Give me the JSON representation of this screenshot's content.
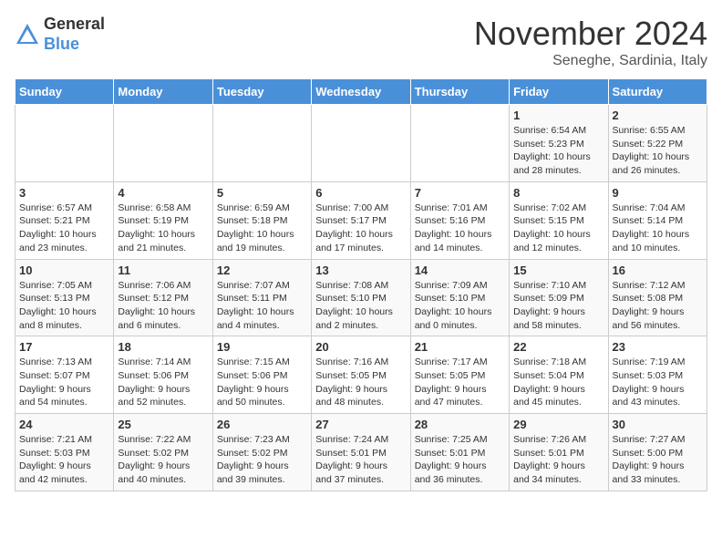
{
  "logo": {
    "general": "General",
    "blue": "Blue"
  },
  "title": "November 2024",
  "location": "Seneghe, Sardinia, Italy",
  "days_of_week": [
    "Sunday",
    "Monday",
    "Tuesday",
    "Wednesday",
    "Thursday",
    "Friday",
    "Saturday"
  ],
  "weeks": [
    [
      {
        "day": "",
        "info": ""
      },
      {
        "day": "",
        "info": ""
      },
      {
        "day": "",
        "info": ""
      },
      {
        "day": "",
        "info": ""
      },
      {
        "day": "",
        "info": ""
      },
      {
        "day": "1",
        "info": "Sunrise: 6:54 AM\nSunset: 5:23 PM\nDaylight: 10 hours\nand 28 minutes."
      },
      {
        "day": "2",
        "info": "Sunrise: 6:55 AM\nSunset: 5:22 PM\nDaylight: 10 hours\nand 26 minutes."
      }
    ],
    [
      {
        "day": "3",
        "info": "Sunrise: 6:57 AM\nSunset: 5:21 PM\nDaylight: 10 hours\nand 23 minutes."
      },
      {
        "day": "4",
        "info": "Sunrise: 6:58 AM\nSunset: 5:19 PM\nDaylight: 10 hours\nand 21 minutes."
      },
      {
        "day": "5",
        "info": "Sunrise: 6:59 AM\nSunset: 5:18 PM\nDaylight: 10 hours\nand 19 minutes."
      },
      {
        "day": "6",
        "info": "Sunrise: 7:00 AM\nSunset: 5:17 PM\nDaylight: 10 hours\nand 17 minutes."
      },
      {
        "day": "7",
        "info": "Sunrise: 7:01 AM\nSunset: 5:16 PM\nDaylight: 10 hours\nand 14 minutes."
      },
      {
        "day": "8",
        "info": "Sunrise: 7:02 AM\nSunset: 5:15 PM\nDaylight: 10 hours\nand 12 minutes."
      },
      {
        "day": "9",
        "info": "Sunrise: 7:04 AM\nSunset: 5:14 PM\nDaylight: 10 hours\nand 10 minutes."
      }
    ],
    [
      {
        "day": "10",
        "info": "Sunrise: 7:05 AM\nSunset: 5:13 PM\nDaylight: 10 hours\nand 8 minutes."
      },
      {
        "day": "11",
        "info": "Sunrise: 7:06 AM\nSunset: 5:12 PM\nDaylight: 10 hours\nand 6 minutes."
      },
      {
        "day": "12",
        "info": "Sunrise: 7:07 AM\nSunset: 5:11 PM\nDaylight: 10 hours\nand 4 minutes."
      },
      {
        "day": "13",
        "info": "Sunrise: 7:08 AM\nSunset: 5:10 PM\nDaylight: 10 hours\nand 2 minutes."
      },
      {
        "day": "14",
        "info": "Sunrise: 7:09 AM\nSunset: 5:10 PM\nDaylight: 10 hours\nand 0 minutes."
      },
      {
        "day": "15",
        "info": "Sunrise: 7:10 AM\nSunset: 5:09 PM\nDaylight: 9 hours\nand 58 minutes."
      },
      {
        "day": "16",
        "info": "Sunrise: 7:12 AM\nSunset: 5:08 PM\nDaylight: 9 hours\nand 56 minutes."
      }
    ],
    [
      {
        "day": "17",
        "info": "Sunrise: 7:13 AM\nSunset: 5:07 PM\nDaylight: 9 hours\nand 54 minutes."
      },
      {
        "day": "18",
        "info": "Sunrise: 7:14 AM\nSunset: 5:06 PM\nDaylight: 9 hours\nand 52 minutes."
      },
      {
        "day": "19",
        "info": "Sunrise: 7:15 AM\nSunset: 5:06 PM\nDaylight: 9 hours\nand 50 minutes."
      },
      {
        "day": "20",
        "info": "Sunrise: 7:16 AM\nSunset: 5:05 PM\nDaylight: 9 hours\nand 48 minutes."
      },
      {
        "day": "21",
        "info": "Sunrise: 7:17 AM\nSunset: 5:05 PM\nDaylight: 9 hours\nand 47 minutes."
      },
      {
        "day": "22",
        "info": "Sunrise: 7:18 AM\nSunset: 5:04 PM\nDaylight: 9 hours\nand 45 minutes."
      },
      {
        "day": "23",
        "info": "Sunrise: 7:19 AM\nSunset: 5:03 PM\nDaylight: 9 hours\nand 43 minutes."
      }
    ],
    [
      {
        "day": "24",
        "info": "Sunrise: 7:21 AM\nSunset: 5:03 PM\nDaylight: 9 hours\nand 42 minutes."
      },
      {
        "day": "25",
        "info": "Sunrise: 7:22 AM\nSunset: 5:02 PM\nDaylight: 9 hours\nand 40 minutes."
      },
      {
        "day": "26",
        "info": "Sunrise: 7:23 AM\nSunset: 5:02 PM\nDaylight: 9 hours\nand 39 minutes."
      },
      {
        "day": "27",
        "info": "Sunrise: 7:24 AM\nSunset: 5:01 PM\nDaylight: 9 hours\nand 37 minutes."
      },
      {
        "day": "28",
        "info": "Sunrise: 7:25 AM\nSunset: 5:01 PM\nDaylight: 9 hours\nand 36 minutes."
      },
      {
        "day": "29",
        "info": "Sunrise: 7:26 AM\nSunset: 5:01 PM\nDaylight: 9 hours\nand 34 minutes."
      },
      {
        "day": "30",
        "info": "Sunrise: 7:27 AM\nSunset: 5:00 PM\nDaylight: 9 hours\nand 33 minutes."
      }
    ]
  ]
}
